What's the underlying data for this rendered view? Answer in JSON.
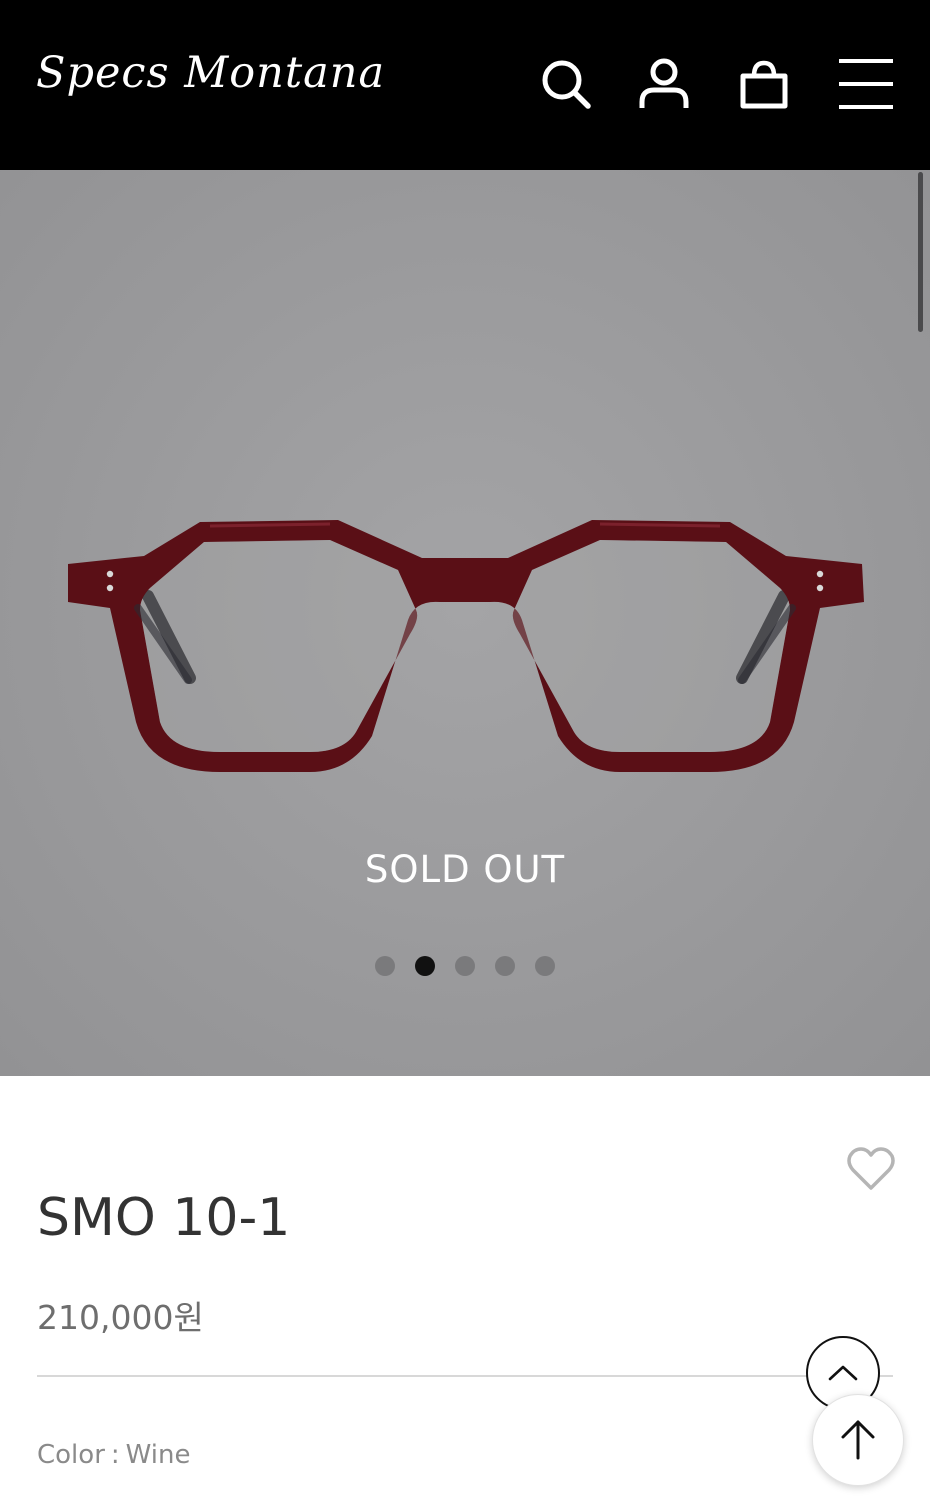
{
  "header": {
    "logo": "Specs Montana",
    "icons": [
      "search-icon",
      "user-icon",
      "shopping-bag-icon",
      "menu-icon"
    ]
  },
  "hero": {
    "status_text": "SOLD OUT",
    "slides_total": 5,
    "active_slide": 2
  },
  "product": {
    "name": "SMO 10-1",
    "price": "210,000원",
    "color_label": "Color",
    "color_separator": ":",
    "color_value": "Wine",
    "frame_color": "#5a0f16"
  },
  "colors": {
    "header_bg": "#000000",
    "hero_bg": "#9a9a9c",
    "text_dark": "#333333"
  }
}
